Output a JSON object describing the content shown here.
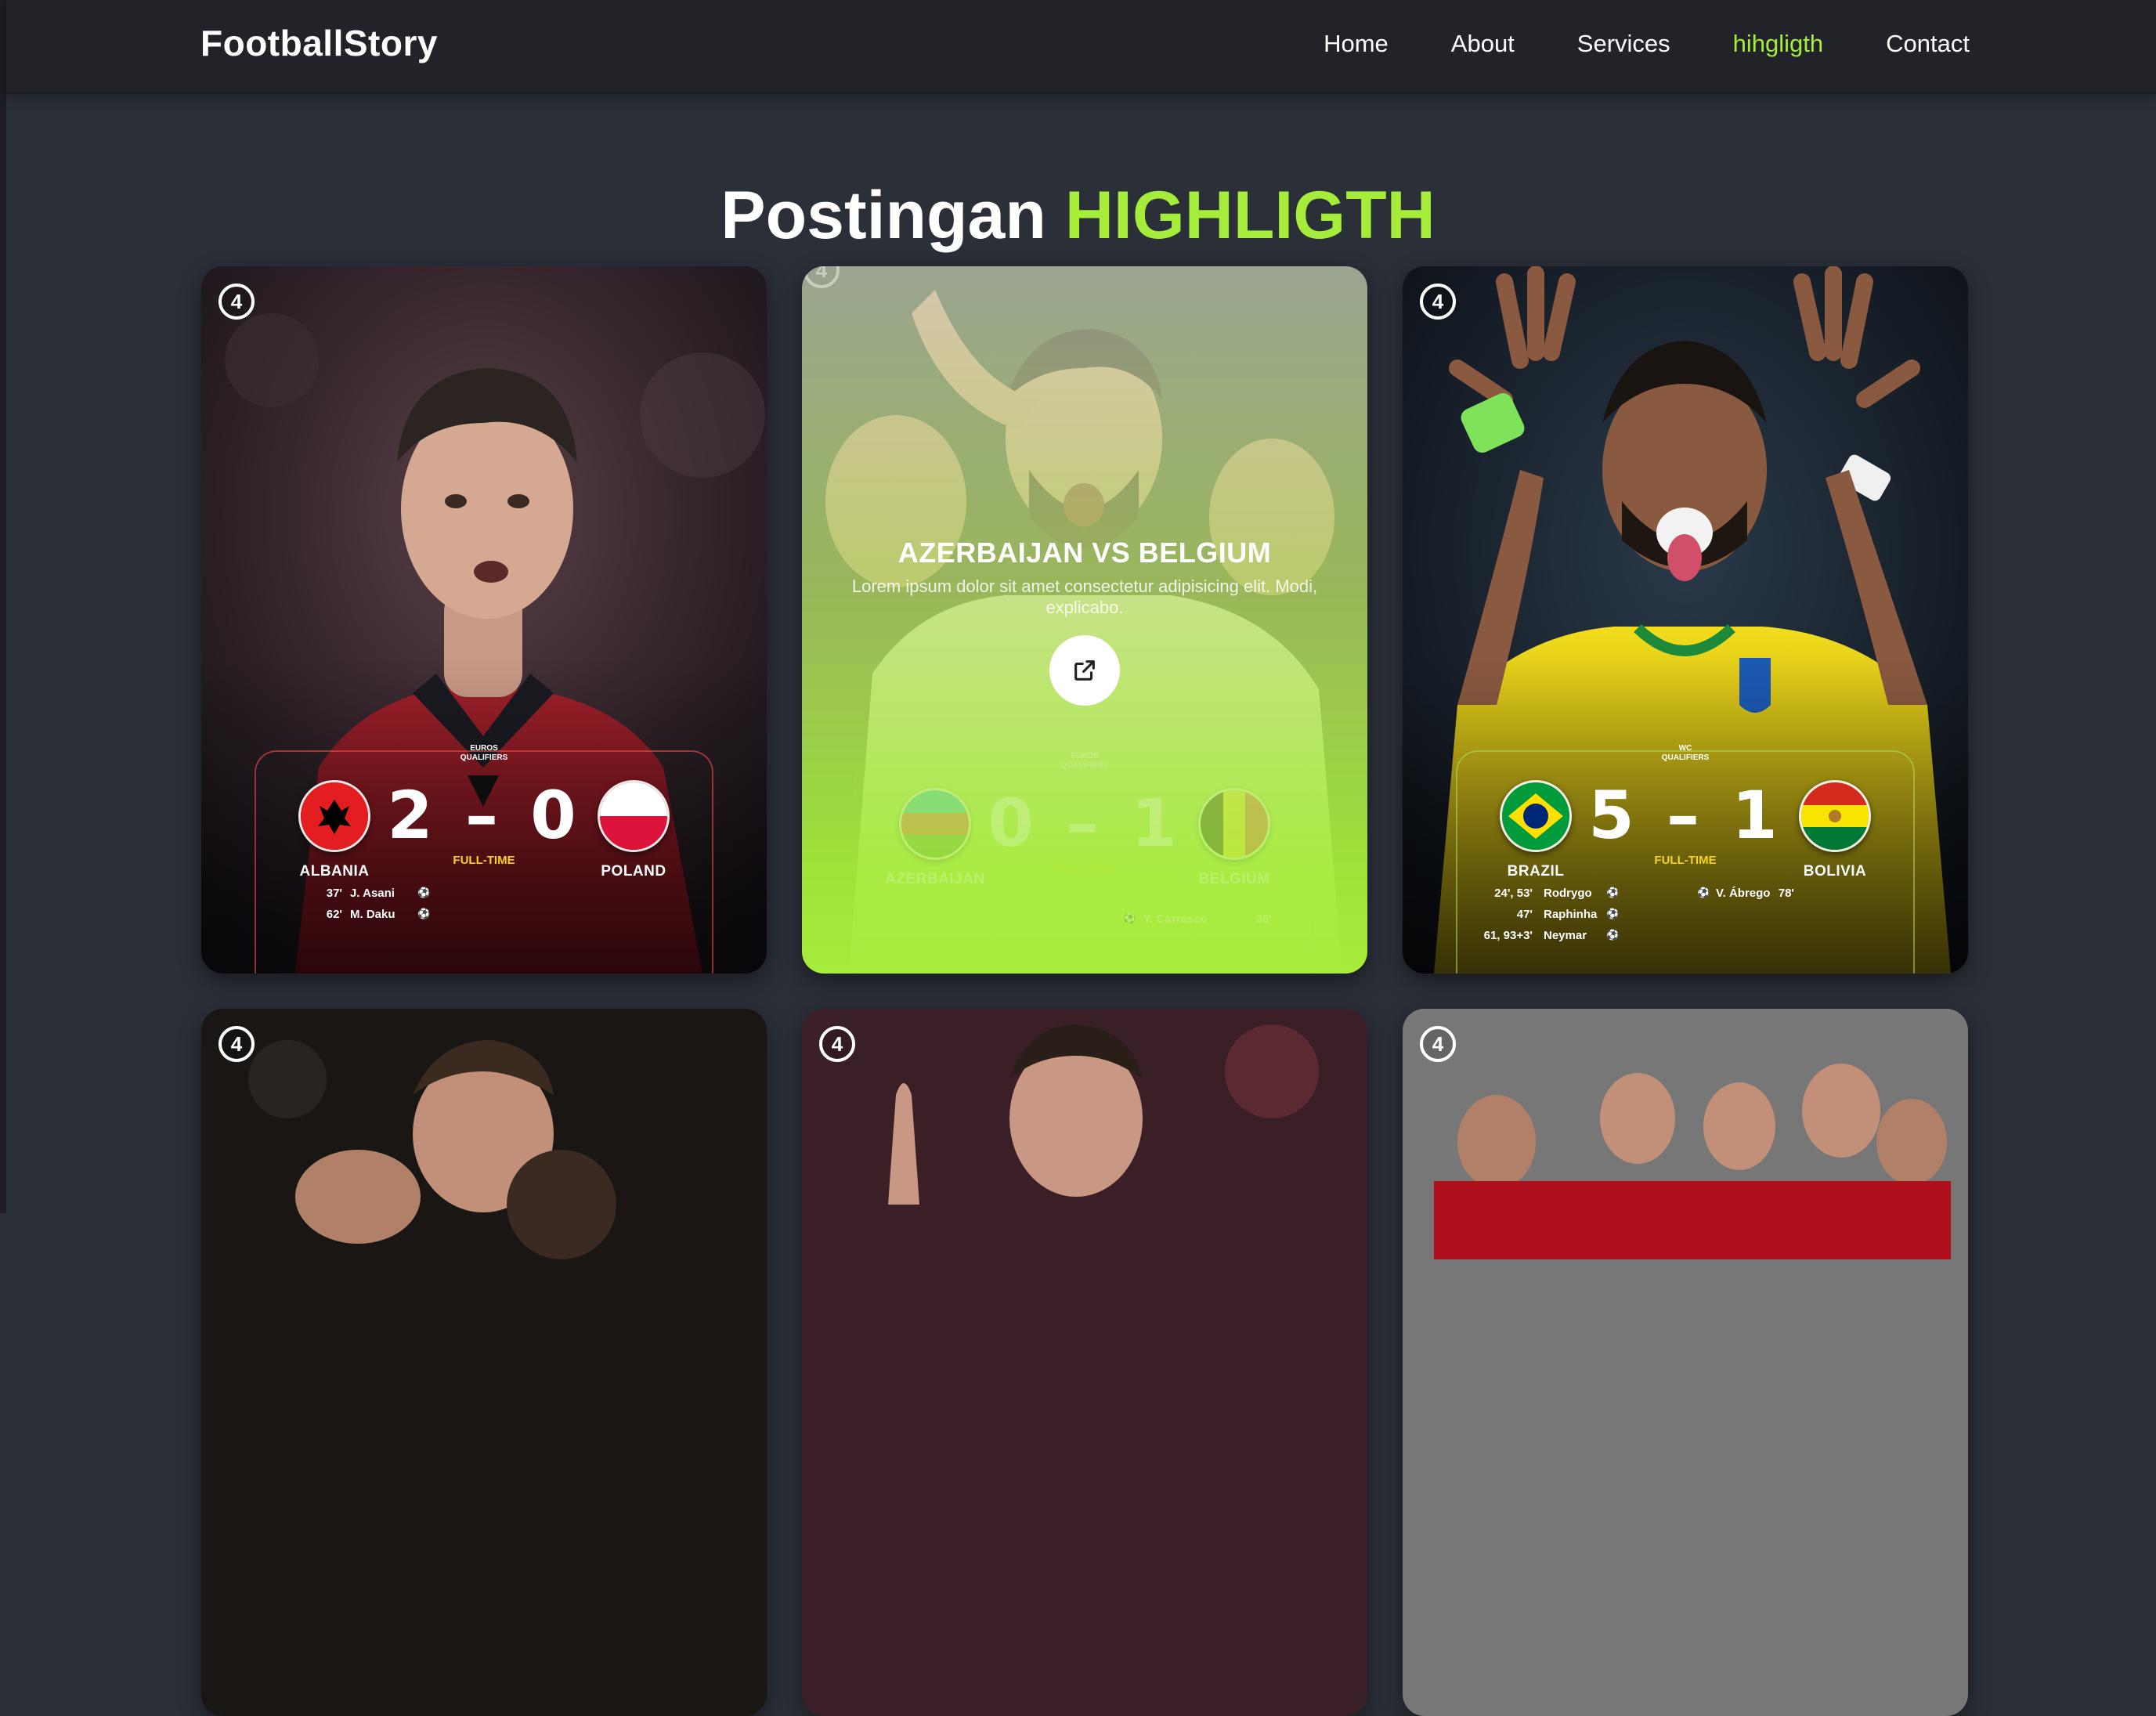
{
  "brand": "FootballStory",
  "nav": [
    {
      "label": "Home",
      "active": false
    },
    {
      "label": "About",
      "active": false
    },
    {
      "label": "Services",
      "active": false
    },
    {
      "label": "hihgligth",
      "active": true
    },
    {
      "label": "Contact",
      "active": false
    }
  ],
  "title": {
    "prefix": "Postingan",
    "accent": "HIGHLIGTH"
  },
  "accent_color": "#a6ec3a",
  "badge_number": "4",
  "cards": [
    {
      "competition": [
        "EUROS",
        "QUALIFIERS"
      ],
      "home": "ALBANIA",
      "away": "POLAND",
      "home_score": "2",
      "away_score": "0",
      "status": "FULL-TIME",
      "home_scorers": [
        {
          "minute": "37'",
          "name": "J. Asani"
        },
        {
          "minute": "62'",
          "name": "M. Daku"
        }
      ],
      "away_scorers": []
    },
    {
      "competition": [
        "EUROS",
        "QUALIFIERS"
      ],
      "home": "AZERBAIJAN",
      "away": "BELGIUM",
      "home_score": "0",
      "away_score": "1",
      "status": "FULL-TIME",
      "away_scorers": [
        {
          "minute": "38'",
          "name": "Y. Carrasco"
        }
      ],
      "overlay_title": "AZERBAIJAN VS BELGIUM",
      "overlay_desc": "Lorem ipsum dolor sit amet consectetur adipisicing elit. Modi, explicabo.",
      "open_icon": "external-link-icon"
    },
    {
      "competition": [
        "WC",
        "QUALIFIERS"
      ],
      "home": "BRAZIL",
      "away": "BOLIVIA",
      "home_score": "5",
      "away_score": "1",
      "status": "FULL-TIME",
      "home_scorers": [
        {
          "minute": "24', 53'",
          "name": "Rodrygo"
        },
        {
          "minute": "47'",
          "name": "Raphinha"
        },
        {
          "minute": "61, 93+3'",
          "name": "Neymar"
        }
      ],
      "away_scorers": [
        {
          "minute": "78'",
          "name": "V. Ábrego"
        }
      ]
    }
  ]
}
